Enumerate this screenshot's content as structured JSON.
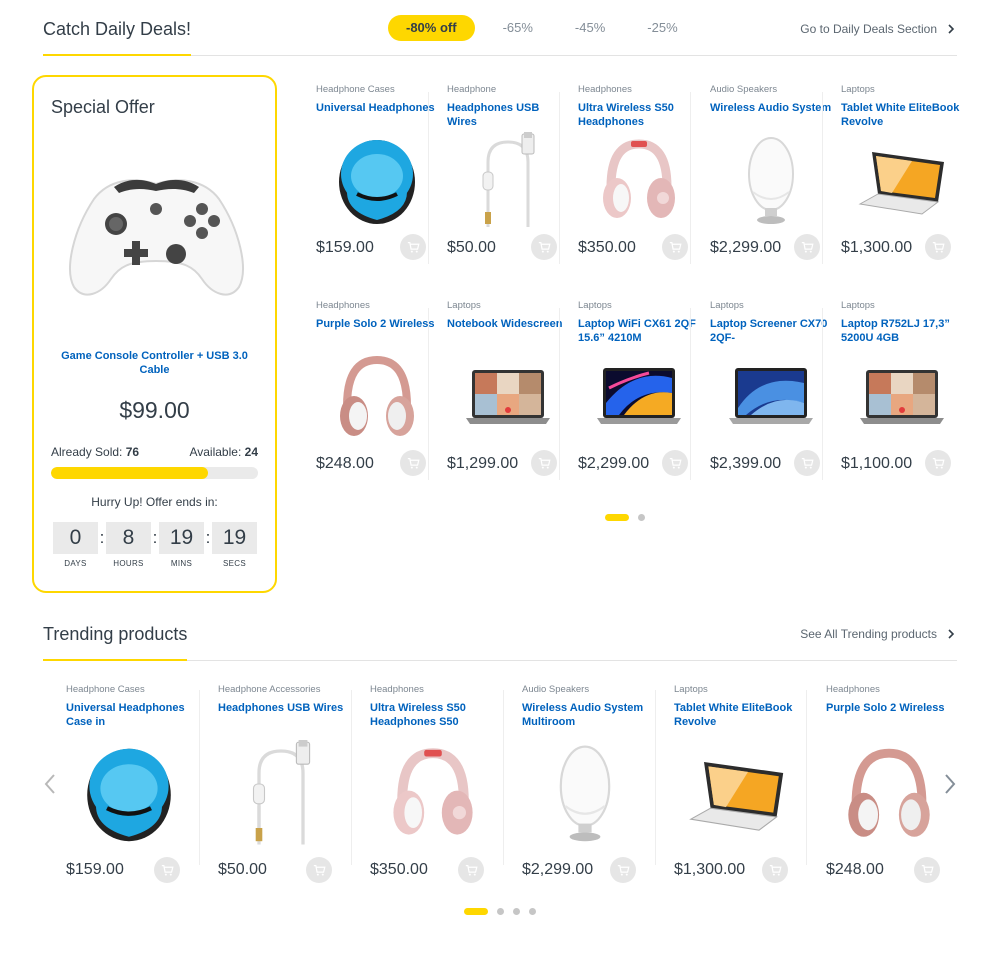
{
  "deals": {
    "title": "Catch Daily Deals!",
    "tabs": [
      "-80% off",
      "-65%",
      "-45%",
      "-25%"
    ],
    "link": "Go to Daily Deals Section"
  },
  "special": {
    "title": "Special Offer",
    "product_name": "Game Console Controller + USB 3.0 Cable",
    "price": "$99.00",
    "sold_label": "Already Sold:",
    "sold_value": "76",
    "available_label": "Available:",
    "available_value": "24",
    "sold_fraction": 0.76,
    "hurry": "Hurry Up! Offer ends in:",
    "countdown": [
      {
        "value": "0",
        "label": "DAYS"
      },
      {
        "value": "8",
        "label": "HOURS"
      },
      {
        "value": "19",
        "label": "MINS"
      },
      {
        "value": "19",
        "label": "SECS"
      }
    ]
  },
  "deal_products": [
    {
      "category": "Headphone Cases",
      "name": "Universal Headphones",
      "price": "$159.00",
      "image": "case-icon"
    },
    {
      "category": "Headphone",
      "name": "Headphones USB Wires",
      "price": "$50.00",
      "image": "usb-cable-icon"
    },
    {
      "category": "Headphones",
      "name": "Ultra Wireless S50 Headphones",
      "price": "$350.00",
      "image": "headphones-pink-icon"
    },
    {
      "category": "Audio Speakers",
      "name": "Wireless Audio System",
      "price": "$2,299.00",
      "image": "speaker-icon"
    },
    {
      "category": "Laptops",
      "name": "Tablet White EliteBook Revolve",
      "price": "$1,300.00",
      "image": "tablet-laptop-icon"
    },
    {
      "category": "Headphones",
      "name": "Purple Solo 2 Wireless",
      "price": "$248.00",
      "image": "headphones-rose-icon"
    },
    {
      "category": "Laptops",
      "name": "Notebook Widescreen",
      "price": "$1,299.00",
      "image": "laptop-video-icon"
    },
    {
      "category": "Laptops",
      "name": "Laptop WiFi CX61 2QF 15.6” 4210M",
      "price": "$2,299.00",
      "image": "macbook-dark-icon"
    },
    {
      "category": "Laptops",
      "name": "Laptop Screener CX70 2QF-",
      "price": "$2,399.00",
      "image": "macbook-blue-icon"
    },
    {
      "category": "Laptops",
      "name": "Laptop R752LJ 17,3” 5200U 4GB",
      "price": "$1,100.00",
      "image": "laptop-video-icon"
    }
  ],
  "trending": {
    "title": "Trending products",
    "link": "See All Trending products",
    "products": [
      {
        "category": "Headphone Cases",
        "name": "Universal Headphones Case in",
        "price": "$159.00",
        "image": "case-icon"
      },
      {
        "category": "Headphone Accessories",
        "name": "Headphones USB Wires",
        "price": "$50.00",
        "image": "usb-cable-icon"
      },
      {
        "category": "Headphones",
        "name": "Ultra Wireless S50 Headphones S50",
        "price": "$350.00",
        "image": "headphones-pink-icon"
      },
      {
        "category": "Audio Speakers",
        "name": "Wireless Audio System Multiroom",
        "price": "$2,299.00",
        "image": "speaker-icon"
      },
      {
        "category": "Laptops",
        "name": "Tablet White EliteBook Revolve",
        "price": "$1,300.00",
        "image": "tablet-laptop-icon"
      },
      {
        "category": "Headphones",
        "name": "Purple Solo 2 Wireless",
        "price": "$248.00",
        "image": "headphones-rose-icon"
      }
    ]
  },
  "colors": {
    "accent": "#fed700",
    "link": "#0062bd",
    "text": "#333e48"
  }
}
